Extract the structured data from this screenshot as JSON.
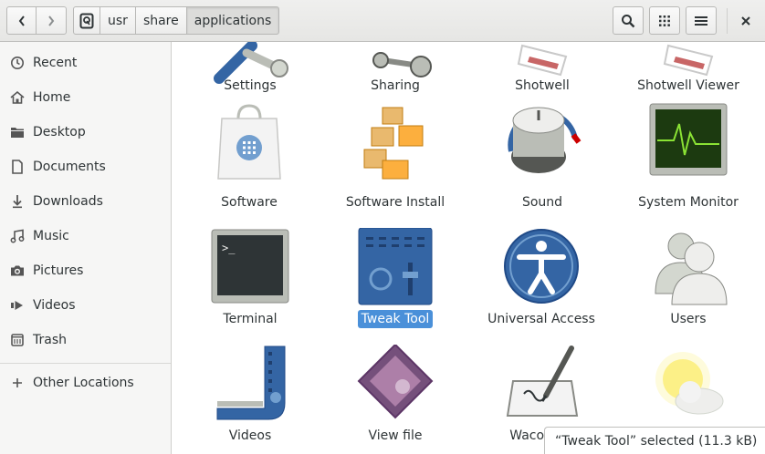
{
  "header": {
    "back_icon": "chevron-left-icon",
    "forward_icon": "chevron-right-icon",
    "path": [
      "usr",
      "share",
      "applications"
    ],
    "root_icon": "drive-icon",
    "search_icon": "search-icon",
    "view_icon": "grid-view-icon",
    "menu_icon": "hamburger-menu-icon",
    "close_icon": "close-icon"
  },
  "sidebar": {
    "items": [
      {
        "label": "Recent",
        "icon": "clock-icon"
      },
      {
        "label": "Home",
        "icon": "home-icon"
      },
      {
        "label": "Desktop",
        "icon": "folder-icon"
      },
      {
        "label": "Documents",
        "icon": "document-icon"
      },
      {
        "label": "Downloads",
        "icon": "download-icon"
      },
      {
        "label": "Music",
        "icon": "music-icon"
      },
      {
        "label": "Pictures",
        "icon": "camera-icon"
      },
      {
        "label": "Videos",
        "icon": "video-icon"
      },
      {
        "label": "Trash",
        "icon": "trash-icon"
      }
    ],
    "other_locations": {
      "label": "Other Locations",
      "icon": "plus-icon"
    }
  },
  "apps": [
    {
      "label": "Settings",
      "icon": "settings-tools-icon"
    },
    {
      "label": "Sharing",
      "icon": "sharing-icon"
    },
    {
      "label": "Shotwell",
      "icon": "shotwell-icon"
    },
    {
      "label": "Shotwell Viewer",
      "icon": "shotwell-viewer-icon"
    },
    {
      "label": "Software",
      "icon": "software-bag-icon"
    },
    {
      "label": "Software Install",
      "icon": "boxes-icon"
    },
    {
      "label": "Sound",
      "icon": "volume-knob-icon"
    },
    {
      "label": "System Monitor",
      "icon": "monitor-graph-icon"
    },
    {
      "label": "Terminal",
      "icon": "terminal-icon"
    },
    {
      "label": "Tweak Tool",
      "icon": "mixer-icon",
      "selected": true
    },
    {
      "label": "Universal Access",
      "icon": "accessibility-icon"
    },
    {
      "label": "Users",
      "icon": "users-icon"
    },
    {
      "label": "Videos",
      "icon": "film-reel-icon"
    },
    {
      "label": "View file",
      "icon": "view-file-icon"
    },
    {
      "label": "Wacom",
      "icon": "tablet-pen-icon"
    },
    {
      "label": "",
      "icon": "weather-icon"
    }
  ],
  "status": "“Tweak Tool” selected  (11.3 kB)",
  "colors": {
    "selection": "#4a90d9",
    "sidebar_bg": "#f6f6f5"
  }
}
